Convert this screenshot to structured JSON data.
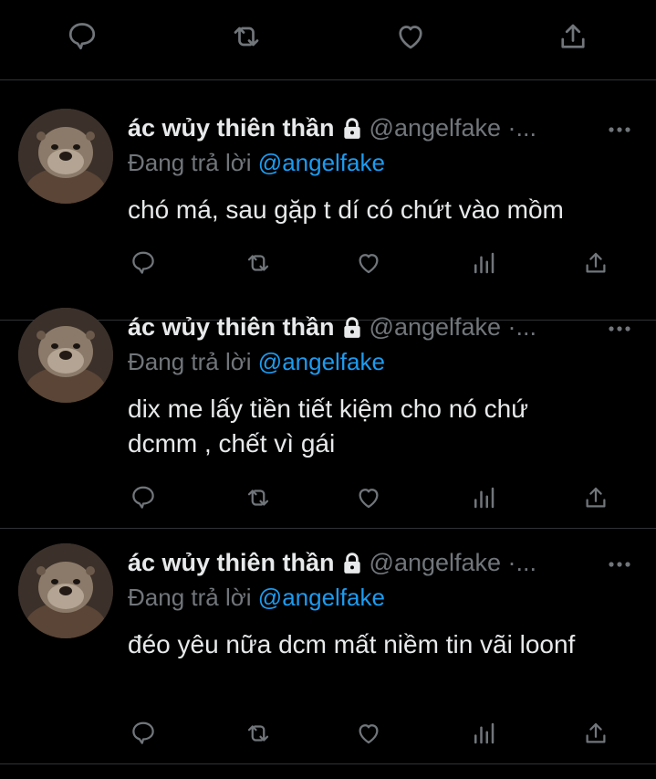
{
  "tweets": [
    {
      "author_name": "ác wủy thiên thần",
      "author_handle": "@angelfake ·...",
      "replying_prefix": "Đang trả lời",
      "replying_to": "@angelfake",
      "text": "chó má, sau gặp t dí có chứt vào mồm"
    },
    {
      "author_name": "ác wủy thiên thần",
      "author_handle": "@angelfake ·...",
      "replying_prefix": "Đang trả lời",
      "replying_to": "@angelfake",
      "text": "dix me lấy tiền tiết kiệm cho nó chứ dcmm , chết vì gái"
    },
    {
      "author_name": "ác wủy thiên thần",
      "author_handle": "@angelfake ·...",
      "replying_prefix": "Đang trả lời",
      "replying_to": "@angelfake",
      "text": "đéo yêu nữa dcm mất niềm tin vãi loonf"
    }
  ],
  "colors": {
    "background": "#000000",
    "text": "#e7e9ea",
    "secondary": "#71767b",
    "link": "#1d9bf0",
    "divider": "#2f3336"
  },
  "icons": {
    "reply": "speech-bubble-icon",
    "retweet": "retweet-icon",
    "like": "heart-icon",
    "views": "bar-chart-icon",
    "share": "share-upload-icon",
    "more": "more-dots-icon",
    "protected": "lock-icon"
  }
}
